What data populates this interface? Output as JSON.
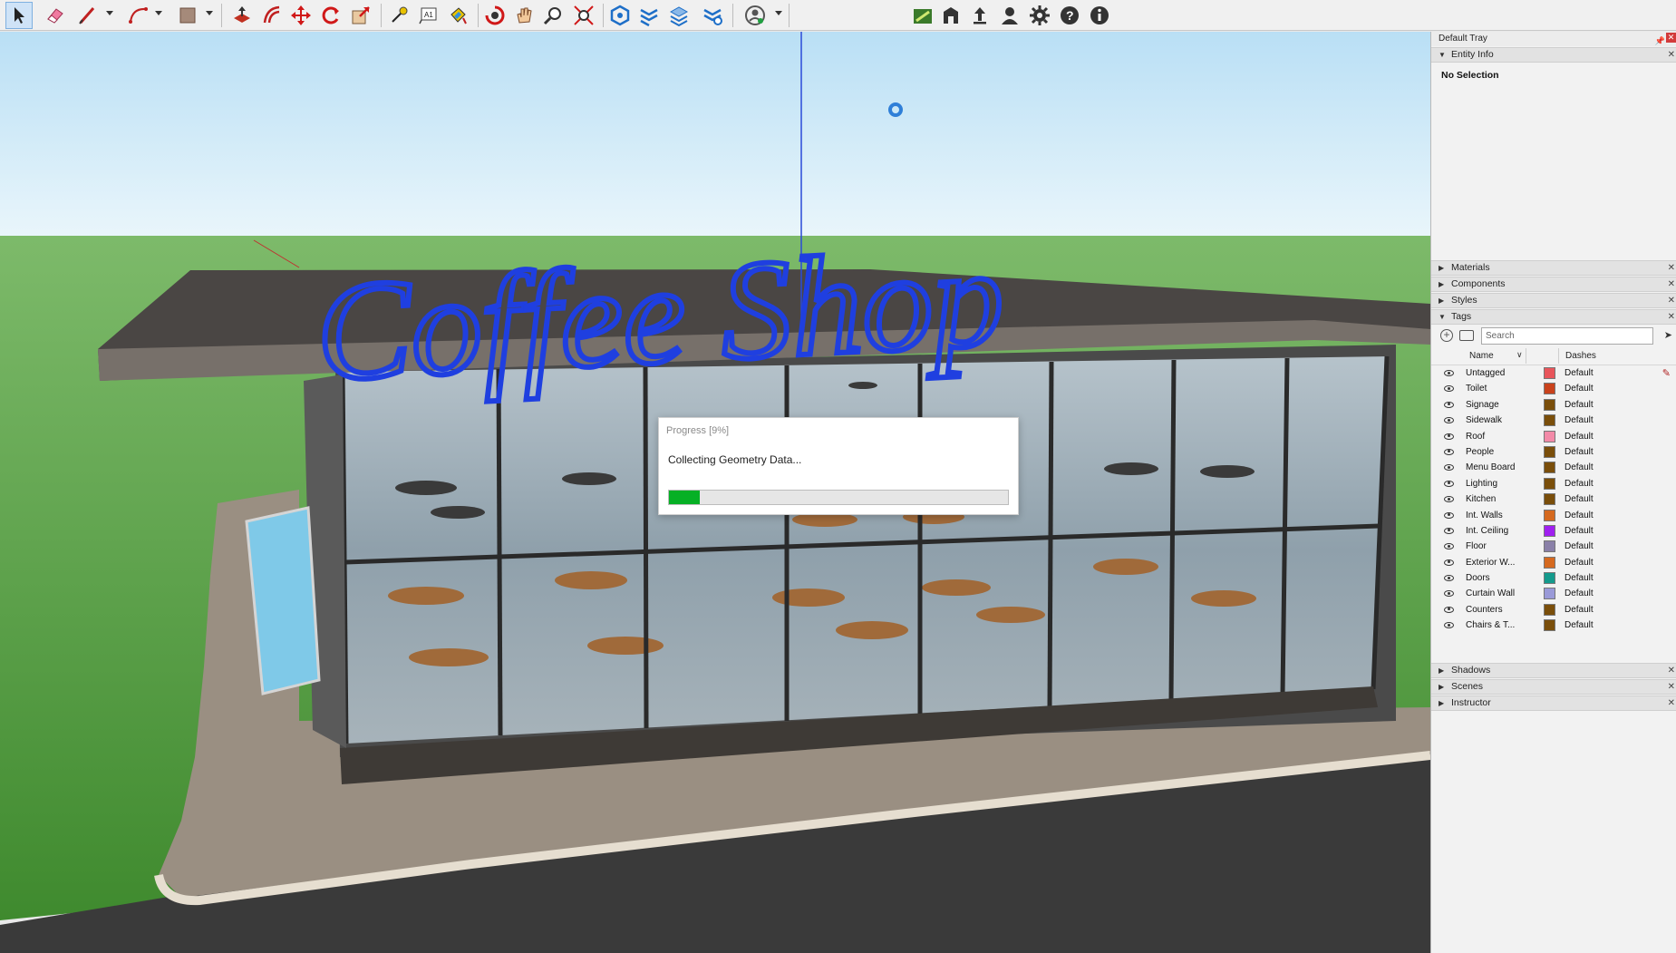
{
  "toolbar": {
    "left_tools": [
      "select-tool",
      "eraser-tool",
      "line-tool",
      "arc-tool",
      "shapes-tool",
      "push-pull-tool",
      "offset-tool",
      "move-tool",
      "rotate-tool",
      "scale-tool",
      "tape-measure-tool",
      "text-tool",
      "paint-bucket-tool",
      "orbit-tool",
      "pan-tool",
      "zoom-tool",
      "zoom-extents-tool",
      "section-plane-tool",
      "section-cut-tool",
      "section-fill-tool",
      "display-section-tool",
      "account-tool"
    ],
    "right_tools": [
      "extension-warehouse-icon",
      "3d-warehouse-icon",
      "upload-icon",
      "profile-icon",
      "settings-icon",
      "help-icon",
      "info-icon"
    ],
    "active_tool": "select-tool"
  },
  "scene": {
    "sign_text": "Coffee Shop"
  },
  "progress": {
    "title": "Progress [9%]",
    "message": "Collecting Geometry Data...",
    "percent": 9,
    "bar_color": "#06b025"
  },
  "tray": {
    "title": "Default Tray",
    "panels": {
      "entity_info": "Entity Info",
      "materials": "Materials",
      "components": "Components",
      "styles": "Styles",
      "tags": "Tags",
      "shadows": "Shadows",
      "scenes": "Scenes",
      "instructor": "Instructor"
    },
    "entity_info": {
      "selection": "No Selection"
    },
    "tags": {
      "search_placeholder": "Search",
      "col_name": "Name",
      "col_dashes": "Dashes",
      "rows": [
        {
          "name": "Untagged",
          "color": "#e8555b",
          "dashes": "Default"
        },
        {
          "name": "Toilet",
          "color": "#c9421c",
          "dashes": "Default"
        },
        {
          "name": "Signage",
          "color": "#7a4e0a",
          "dashes": "Default"
        },
        {
          "name": "Sidewalk",
          "color": "#7a4e0a",
          "dashes": "Default"
        },
        {
          "name": "Roof",
          "color": "#f38aa8",
          "dashes": "Default"
        },
        {
          "name": "People",
          "color": "#7a4e0a",
          "dashes": "Default"
        },
        {
          "name": "Menu Board",
          "color": "#7a4e0a",
          "dashes": "Default"
        },
        {
          "name": "Lighting",
          "color": "#7a4e0a",
          "dashes": "Default"
        },
        {
          "name": "Kitchen",
          "color": "#7a4e0a",
          "dashes": "Default"
        },
        {
          "name": "Int. Walls",
          "color": "#d5691f",
          "dashes": "Default"
        },
        {
          "name": "Int. Ceiling",
          "color": "#a020f0",
          "dashes": "Default"
        },
        {
          "name": "Floor",
          "color": "#8a80a8",
          "dashes": "Default"
        },
        {
          "name": "Exterior W...",
          "color": "#d5691f",
          "dashes": "Default"
        },
        {
          "name": "Doors",
          "color": "#149a8c",
          "dashes": "Default"
        },
        {
          "name": "Curtain Wall",
          "color": "#9a9ad8",
          "dashes": "Default"
        },
        {
          "name": "Counters",
          "color": "#7a4e0a",
          "dashes": "Default"
        },
        {
          "name": "Chairs & T...",
          "color": "#7a4e0a",
          "dashes": "Default"
        }
      ]
    }
  }
}
